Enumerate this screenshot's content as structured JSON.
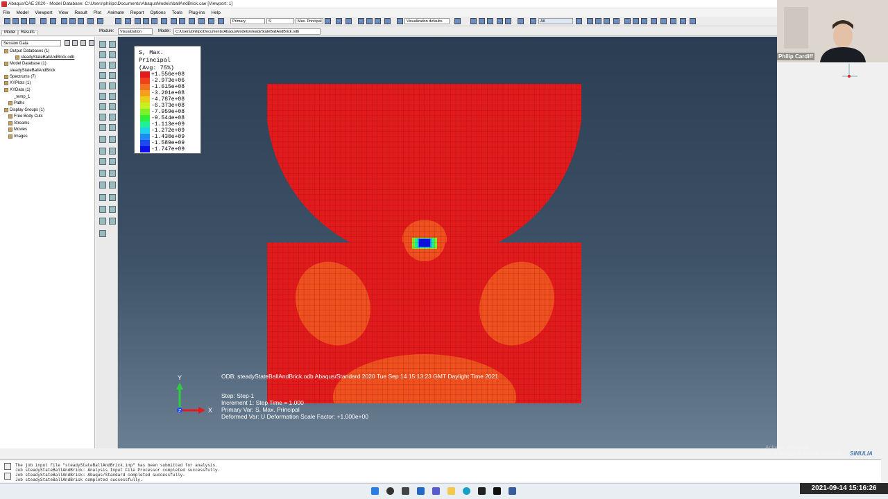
{
  "window": {
    "title": "Abaqus/CAE 2020 - Model Database: C:\\Users\\philipc\\Documents\\AbaqusModels\\ballAndBrick.cae [Viewport: 1]"
  },
  "menu": [
    "File",
    "Model",
    "Viewport",
    "View",
    "Result",
    "Plot",
    "Animate",
    "Report",
    "Options",
    "Tools",
    "Plug-ins",
    "Help"
  ],
  "toolbar": {
    "var_position": "Primary",
    "var_name": "S",
    "invariant": "Max. Principal",
    "view_defaults": "Visualization defaults",
    "selection_filter": "All"
  },
  "context": {
    "module_label": "Module:",
    "module_value": "Visualization",
    "model_label": "Model:",
    "model_value": "C:/Users/philipc/Documents/AbaqusModels/steadyStateBallAndBrick.odb"
  },
  "tabs": [
    "Model",
    "Results"
  ],
  "session_combo": "Session Data",
  "tree": [
    "Output Databases (1)",
    "steadyStateBallAndBrick.odb",
    "Model Database (1)",
    "steadyStateBallAndBrick",
    "Spectrums (7)",
    "XYPlots (1)",
    "XYData (1)",
    "_temp_1",
    "Paths",
    "Display Groups (1)",
    "Free Body Cuts",
    "Streams",
    "Movies",
    "Images"
  ],
  "legend": {
    "title1": "S, Max. Principal",
    "title2": "(Avg: 75%)",
    "entries": [
      {
        "value": "+1.556e+08",
        "color": "#e31a1c"
      },
      {
        "value": "-2.973e+06",
        "color": "#f0401e"
      },
      {
        "value": "-1.615e+08",
        "color": "#f2711e"
      },
      {
        "value": "-3.201e+08",
        "color": "#f49f1b"
      },
      {
        "value": "-4.787e+08",
        "color": "#e8cf1a"
      },
      {
        "value": "-6.373e+08",
        "color": "#c8f020"
      },
      {
        "value": "-7.959e+08",
        "color": "#7df028"
      },
      {
        "value": "-9.544e+08",
        "color": "#2ff034"
      },
      {
        "value": "-1.113e+09",
        "color": "#1ef09a"
      },
      {
        "value": "-1.272e+09",
        "color": "#1ed0e8"
      },
      {
        "value": "-1.430e+09",
        "color": "#1e8cf0"
      },
      {
        "value": "-1.589e+09",
        "color": "#1e48f0"
      },
      {
        "value": "-1.747e+09",
        "color": "#0a10e8"
      }
    ]
  },
  "info": {
    "odb_line": "ODB: steadyStateBallAndBrick.odb    Abaqus/Standard 2020    Tue Sep 14 15:13:23 GMT Daylight Time 2021",
    "step": "Step: Step-1",
    "increment": "Increment      1: Step Time =      1.000",
    "primary_var": "Primary Var: S, Max. Principal",
    "deformed_var": "Deformed Var: U   Deformation Scale Factor: +1.000e+00"
  },
  "triad": {
    "y": "Y",
    "x": "X",
    "z": "Z"
  },
  "webcam": {
    "name": "Philip Cardiff"
  },
  "messages": [
    "The job input file \"steadyStateBallAndBrick.inp\" has been submitted for analysis.",
    "Job steadyStateBallAndBrick: Analysis Input File Processor completed successfully.",
    "Job steadyStateBallAndBrick: Abaqus/Standard completed successfully.",
    "Job steadyStateBallAndBrick completed successfully."
  ],
  "watermark": {
    "line1": "Activate Windows",
    "line2": "Go to Settings to activate Windows."
  },
  "brand": "SIMULIA",
  "clock": "2021-09-14 15:16:26",
  "colors": {
    "viewport_top": "#2b3d52",
    "mesh_red": "#e31a1c",
    "mesh_orange": "#f0501e"
  }
}
